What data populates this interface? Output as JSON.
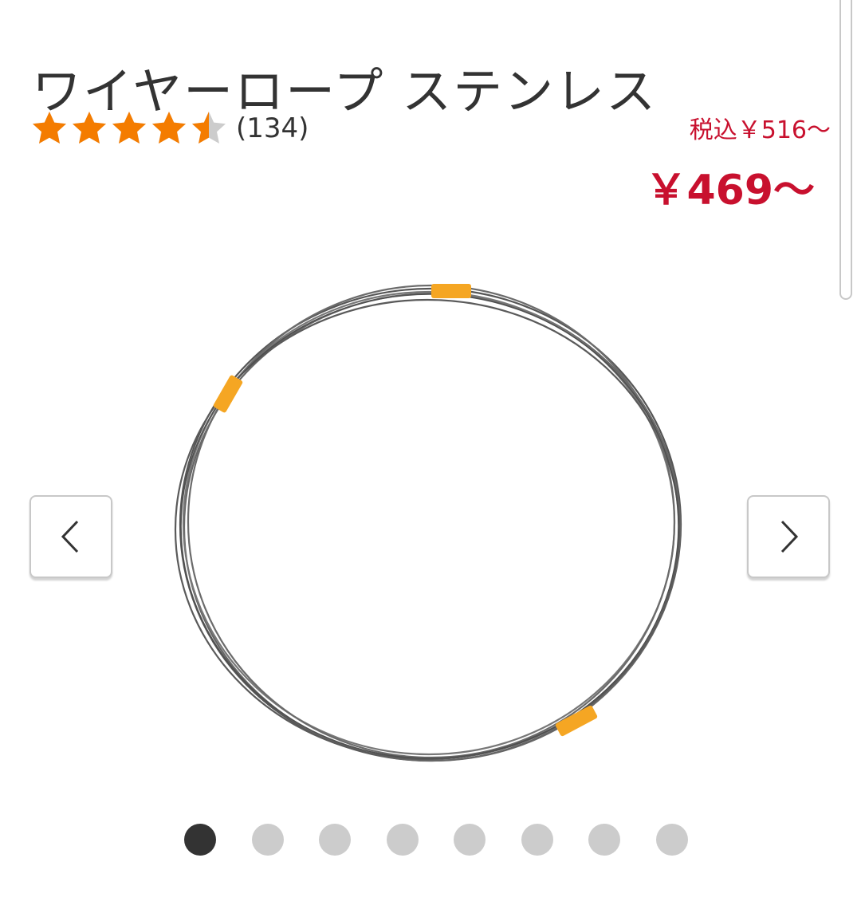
{
  "product": {
    "title": "ワイヤーロープ ステンレス",
    "rating": {
      "value": 4.5,
      "max": 5,
      "count_label": "(134)"
    },
    "price_tax_included": "税込￥516〜",
    "price": "￥469〜"
  },
  "gallery": {
    "image_icon": "coiled-wire-rope-image",
    "prev_icon": "chevron-left-icon",
    "next_icon": "chevron-right-icon",
    "slide_count": 8,
    "active_slide": 1
  },
  "colors": {
    "star": "#f47c00",
    "star_empty": "#cccccc",
    "price": "#c8102e",
    "active_dot": "#333333",
    "inactive_dot": "#cccccc",
    "wire": "#555555",
    "wire_band": "#f5a623"
  }
}
